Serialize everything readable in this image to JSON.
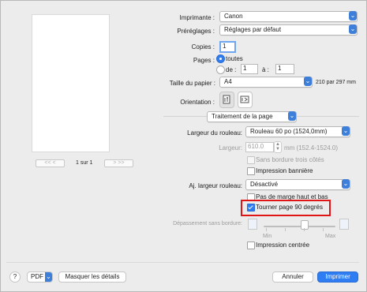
{
  "printer": {
    "label": "Imprimante :",
    "value": "Canon"
  },
  "presets": {
    "label": "Préréglages :",
    "value": "Réglages par défaut"
  },
  "copies": {
    "label": "Copies :",
    "value": "1"
  },
  "pages": {
    "label": "Pages :",
    "all_label": "toutes",
    "from_label": "de :",
    "from_value": "1",
    "to_label": "à :",
    "to_value": "1"
  },
  "paper_size": {
    "label": "Taille du papier :",
    "value": "A4",
    "dimensions": "210 par 297 mm"
  },
  "orientation": {
    "label": "Orientation :"
  },
  "section": {
    "value": "Traitement de la page"
  },
  "roll_width": {
    "label": "Largeur du rouleau:",
    "value": "Rouleau 60 po (1524,0mm)"
  },
  "width": {
    "label": "Largeur:",
    "value": "610.0",
    "hint": "mm (152.4-1524.0)"
  },
  "checkboxes": {
    "borderless_three_sides": "Sans bordure trois côtés",
    "banner_printing": "Impression bannière",
    "no_top_bottom_margin": "Pas de marge haut et bas",
    "rotate_90": "Tourner page 90 degrés",
    "centered_printing": "Impression centrée"
  },
  "roll_adjust": {
    "label": "Aj. largeur rouleau:",
    "value": "Désactivé"
  },
  "overflow": {
    "label": "Dépassement sans bordure:",
    "min_label": "Min",
    "max_label": "Max"
  },
  "preview_nav": {
    "page_indicator": "1 sur 1"
  },
  "footer": {
    "help": "?",
    "pdf_label": "PDF",
    "details_label": "Masquer les détails",
    "cancel_label": "Annuler",
    "print_label": "Imprimer"
  },
  "colors": {
    "accent": "#2f7df3",
    "highlight": "#e01616",
    "window_bg": "#ececec"
  },
  "icons": [
    "portrait-orientation-icon",
    "landscape-orientation-icon",
    "paper-icon",
    "dropdown-chevron-icon"
  ]
}
